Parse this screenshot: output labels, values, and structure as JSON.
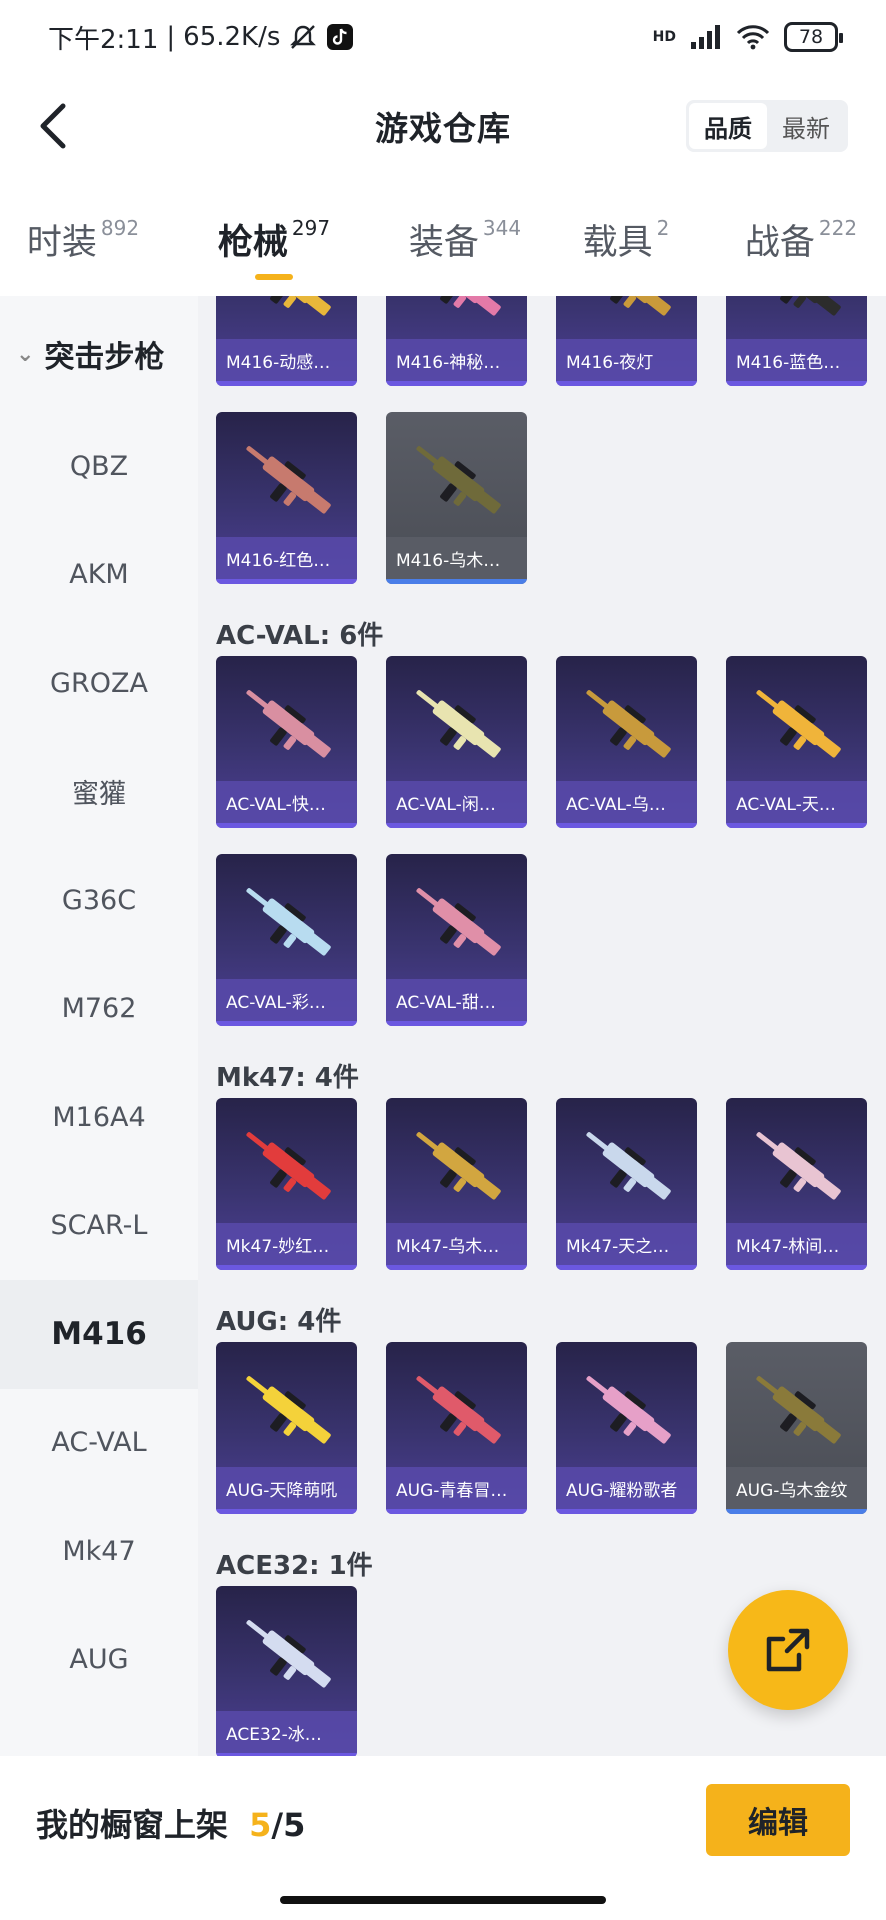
{
  "status_bar": {
    "time": "下午2:11",
    "net_speed": "65.2K/s",
    "battery": "78",
    "network": "HD"
  },
  "header": {
    "title": "游戏仓库",
    "sort_options": [
      {
        "label": "品质",
        "active": true
      },
      {
        "label": "最新",
        "active": false
      }
    ]
  },
  "tabs": [
    {
      "label": "时装",
      "count": "892",
      "active": false
    },
    {
      "label": "枪械",
      "count": "297",
      "active": true
    },
    {
      "label": "装备",
      "count": "344",
      "active": false
    },
    {
      "label": "载具",
      "count": "2",
      "active": false
    },
    {
      "label": "战备",
      "count": "222",
      "active": false
    }
  ],
  "sidebar": {
    "group": "突击步枪",
    "items": [
      {
        "label": "QBZ",
        "active": false
      },
      {
        "label": "AKM",
        "active": false
      },
      {
        "label": "GROZA",
        "active": false
      },
      {
        "label": "蜜獾",
        "active": false
      },
      {
        "label": "G36C",
        "active": false
      },
      {
        "label": "M762",
        "active": false
      },
      {
        "label": "M16A4",
        "active": false
      },
      {
        "label": "SCAR-L",
        "active": false
      },
      {
        "label": "M416",
        "active": true
      },
      {
        "label": "AC-VAL",
        "active": false
      },
      {
        "label": "Mk47",
        "active": false
      },
      {
        "label": "AUG",
        "active": false
      },
      {
        "label": "ACE32",
        "active": false
      }
    ]
  },
  "groups": [
    {
      "title": "",
      "items": [
        {
          "label": "M416-动感…",
          "gray": false,
          "color": "#e8b73a"
        },
        {
          "label": "M416-神秘…",
          "gray": false,
          "color": "#e37aa8"
        },
        {
          "label": "M416-夜灯",
          "gray": false,
          "color": "#c99a3a"
        },
        {
          "label": "M416-蓝色…",
          "gray": false,
          "color": "#2c2c2c"
        },
        {
          "label": "M416-红色…",
          "gray": false,
          "color": "#c77a6e"
        },
        {
          "label": "M416-乌木…",
          "gray": true,
          "color": "#6f6a3a"
        }
      ]
    },
    {
      "title": "AC-VAL: 6件",
      "items": [
        {
          "label": "AC-VAL-快…",
          "gray": false,
          "color": "#d98fa1"
        },
        {
          "label": "AC-VAL-闲…",
          "gray": false,
          "color": "#e8e4b0"
        },
        {
          "label": "AC-VAL-乌…",
          "gray": false,
          "color": "#c89a3c"
        },
        {
          "label": "AC-VAL-天…",
          "gray": false,
          "color": "#f0b43a"
        },
        {
          "label": "AC-VAL-彩…",
          "gray": false,
          "color": "#b8dcf0"
        },
        {
          "label": "AC-VAL-甜…",
          "gray": false,
          "color": "#e08fa8"
        }
      ]
    },
    {
      "title": "Mk47: 4件",
      "items": [
        {
          "label": "Mk47-妙红…",
          "gray": false,
          "color": "#e23c3c"
        },
        {
          "label": "Mk47-乌木…",
          "gray": false,
          "color": "#d2a640"
        },
        {
          "label": "Mk47-天之…",
          "gray": false,
          "color": "#c9d8ec"
        },
        {
          "label": "Mk47-林间…",
          "gray": false,
          "color": "#e8c4d2"
        }
      ]
    },
    {
      "title": "AUG: 4件",
      "items": [
        {
          "label": "AUG-天降萌吼",
          "gray": false,
          "color": "#f4d23a"
        },
        {
          "label": "AUG-青春冒…",
          "gray": false,
          "color": "#e05a6a"
        },
        {
          "label": "AUG-耀粉歌者",
          "gray": false,
          "color": "#e6a0c8"
        },
        {
          "label": "AUG-乌木金纹",
          "gray": true,
          "color": "#8a7a3a"
        }
      ]
    },
    {
      "title": "ACE32: 1件",
      "items": [
        {
          "label": "ACE32-冰…",
          "gray": false,
          "color": "#d4dcf0"
        }
      ]
    }
  ],
  "bottom": {
    "shelf_label": "我的橱窗上架",
    "shelf_current": "5",
    "shelf_total": "/5",
    "edit_label": "编辑"
  }
}
